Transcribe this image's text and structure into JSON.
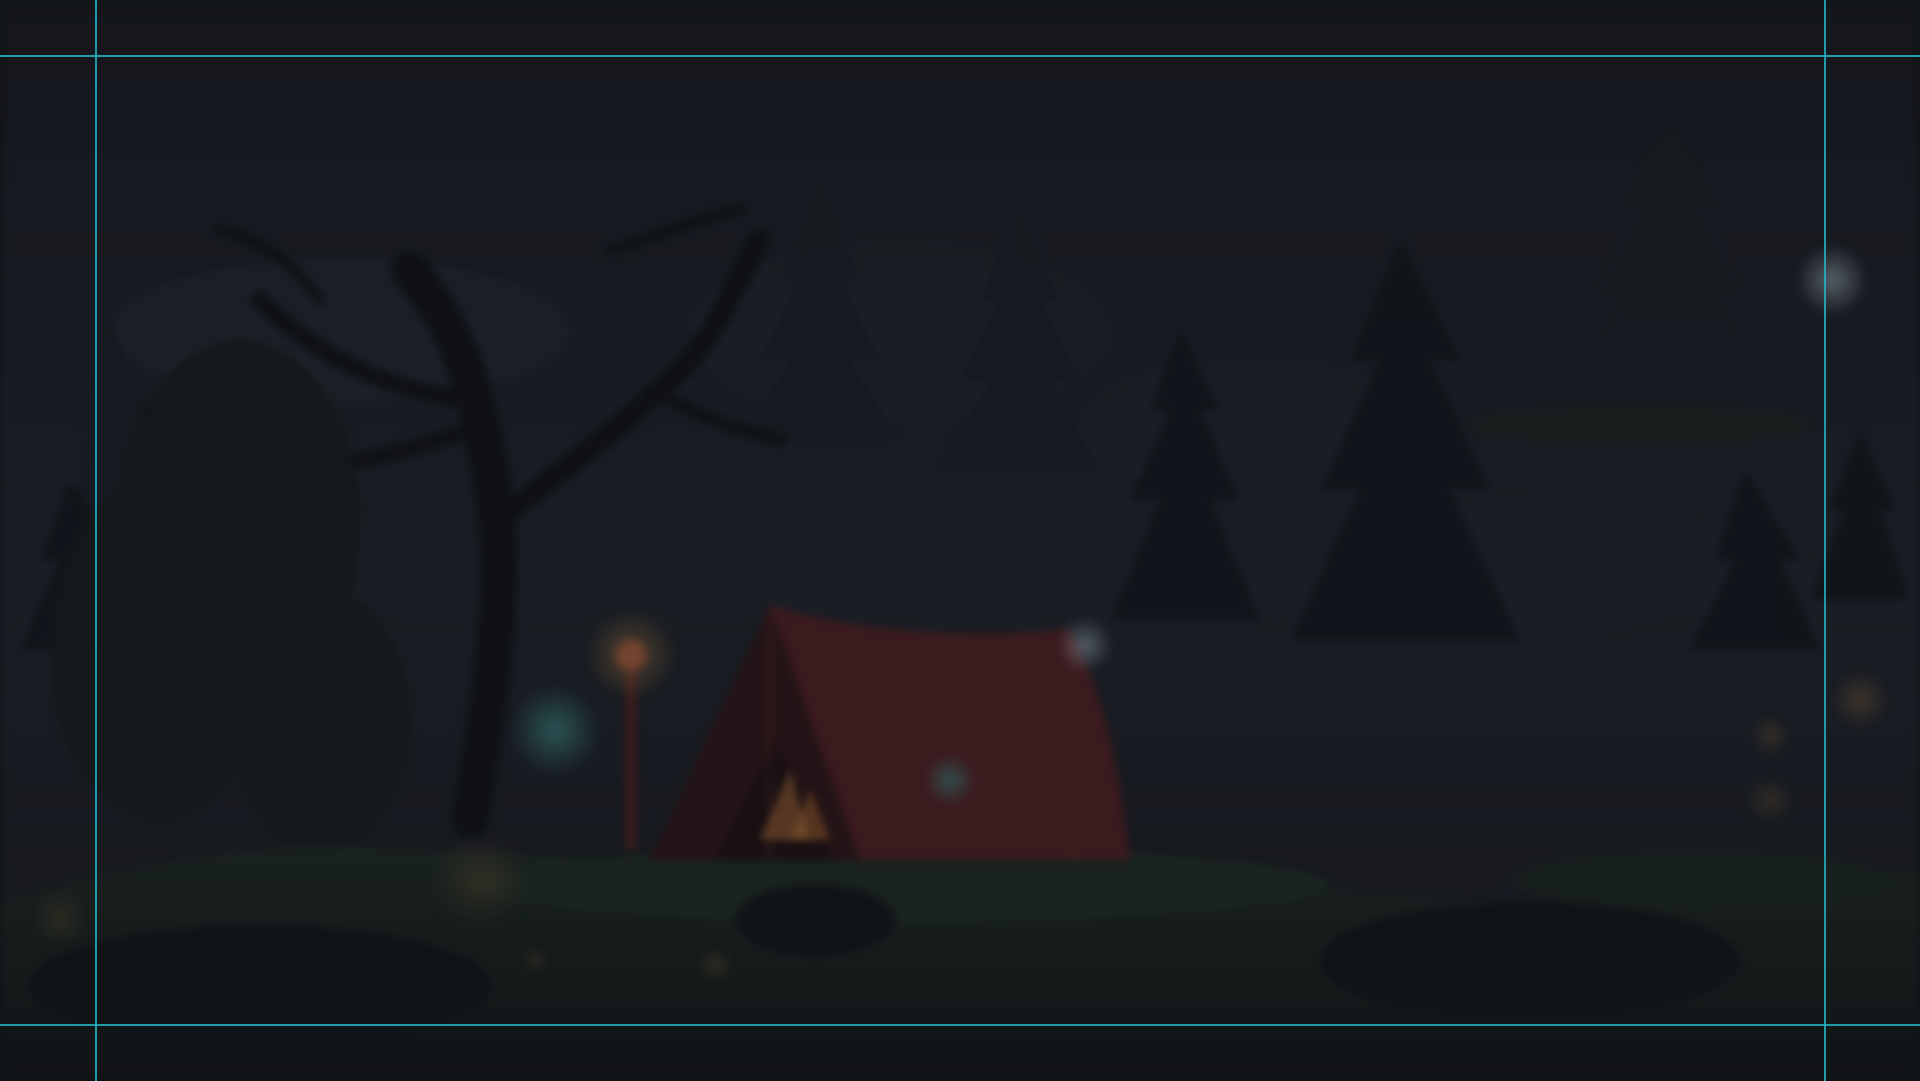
{
  "screen": {
    "type": "game-scene",
    "scene_elements": [
      "night-forest",
      "red-tent",
      "campfire",
      "lantern-post",
      "twisted-tree",
      "pine-trees",
      "fireflies"
    ],
    "overlay": "dimmed-pause-state"
  },
  "colors": {
    "background": "#121419",
    "sky": "#1a1f27",
    "tree_dark": "#11141a",
    "tent": "#4a1c1f",
    "tent_shadow": "#2b1316",
    "grass": "#1d2a24",
    "fire": "#b86a2a",
    "lantern_glow": "#2b6a69",
    "guide_line": "#24b3c4"
  }
}
